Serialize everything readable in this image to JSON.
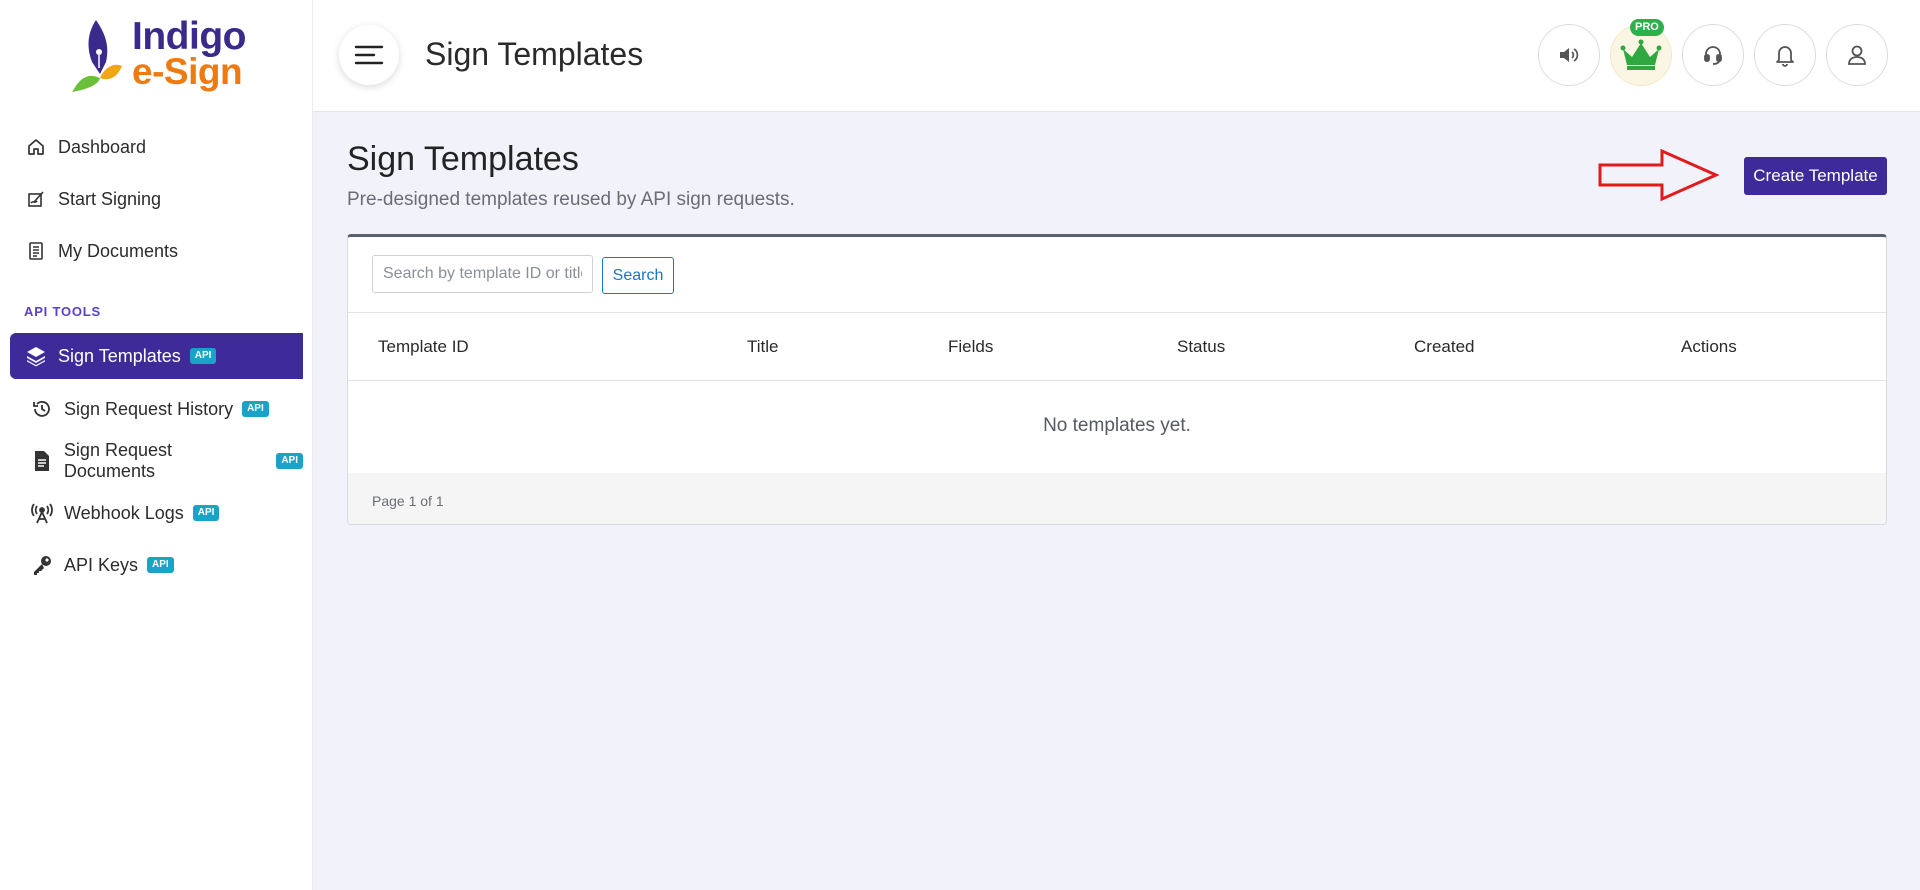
{
  "brand": {
    "line1": "Indigo",
    "line2": "e-Sign"
  },
  "sidebar": {
    "items": [
      {
        "label": "Dashboard",
        "icon": "home-icon"
      },
      {
        "label": "Start Signing",
        "icon": "sign-pen-icon"
      },
      {
        "label": "My Documents",
        "icon": "document-icon"
      }
    ],
    "section_label": "API TOOLS",
    "api_items": [
      {
        "label": "Sign Templates",
        "badge": "API",
        "icon": "layers-icon",
        "active": true
      },
      {
        "label": "Sign Request History",
        "badge": "API",
        "icon": "history-icon"
      },
      {
        "label": "Sign Request Documents",
        "badge": "API",
        "icon": "file-icon"
      },
      {
        "label": "Webhook Logs",
        "badge": "API",
        "icon": "broadcast-icon"
      },
      {
        "label": "API Keys",
        "badge": "API",
        "icon": "key-icon"
      }
    ]
  },
  "topbar": {
    "title": "Sign Templates",
    "pro_label": "PRO",
    "icons": [
      "volume-icon",
      "crown-icon",
      "headset-icon",
      "bell-icon",
      "user-icon"
    ]
  },
  "main": {
    "title": "Sign Templates",
    "subtitle": "Pre-designed templates reused by API sign requests.",
    "create_button": "Create Template",
    "search": {
      "placeholder": "Search by template ID or title",
      "value": "",
      "button": "Search"
    },
    "table": {
      "columns": [
        "Template ID",
        "Title",
        "Fields",
        "Status",
        "Created",
        "Actions"
      ],
      "rows": [],
      "empty_text": "No templates yet."
    },
    "pagination": "Page 1 of 1"
  },
  "colors": {
    "primary": "#3f2a9a",
    "accent_orange": "#ee7a12",
    "api_badge": "#1aa3c7",
    "pro_green": "#2bb04a",
    "arrow_red": "#e01b1b"
  }
}
